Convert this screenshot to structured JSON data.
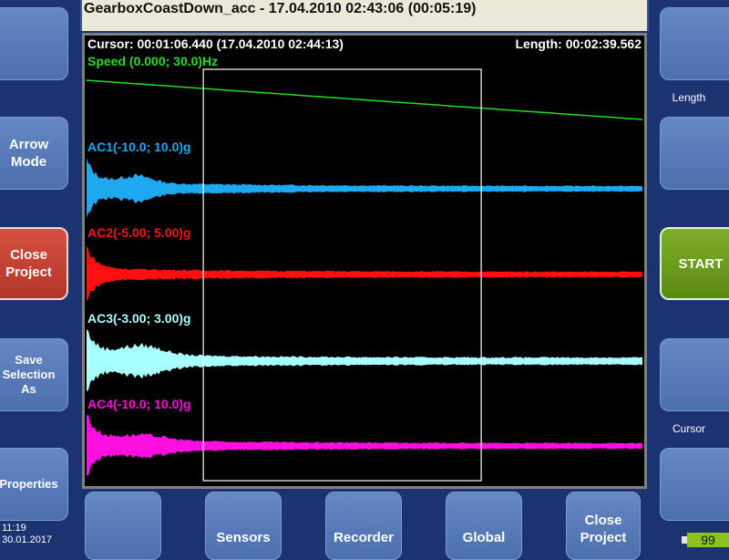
{
  "title": "GearboxCoastDown_acc - 17.04.2010 02:43:06 (00:05:19)",
  "cursor_text": "Cursor: 00:01:06.440 (17.04.2010 02:44:13)",
  "length_text": "Length: 00:02:39.562",
  "left_buttons": [
    {
      "label": ""
    },
    {
      "label": "Arrow Mode"
    },
    {
      "label": "Close Project"
    },
    {
      "label": "Save Selection As"
    },
    {
      "label": "Properties"
    }
  ],
  "right": {
    "length_label": "Length",
    "start_label": "START",
    "cursor_label": "Cursor"
  },
  "bottom_buttons": [
    {
      "label": ""
    },
    {
      "label": "Sensors"
    },
    {
      "label": "Recorder"
    },
    {
      "label": "Global"
    },
    {
      "label": "Close Project"
    }
  ],
  "clock": {
    "time": "11:19",
    "date": "30.01.2017"
  },
  "battery": "99",
  "chart_data": {
    "type": "line",
    "x_range_seconds": [
      0,
      319
    ],
    "selection": {
      "start_fraction": 0.21,
      "end_fraction": 0.71
    },
    "cursor_time": "00:01:06.440",
    "series": [
      {
        "name": "Speed",
        "label": "Speed (0.000; 30.0)Hz",
        "unit": "Hz",
        "range": [
          0.0,
          30.0
        ],
        "color": "#22dd22",
        "start": 22.7,
        "end": 18.0
      },
      {
        "name": "AC1",
        "label": "AC1(-10.0; 10.0)g",
        "unit": "g",
        "range": [
          -10.0,
          10.0
        ],
        "color": "#1ea8f0"
      },
      {
        "name": "AC2",
        "label": "AC2(-5.00; 5.00)g",
        "unit": "g",
        "range": [
          -5.0,
          5.0
        ],
        "color": "#ff1010"
      },
      {
        "name": "AC3",
        "label": "AC3(-3.00; 3.00)g",
        "unit": "g",
        "range": [
          -3.0,
          3.0
        ],
        "color": "#a8ffff"
      },
      {
        "name": "AC4",
        "label": "AC4(-10.0; 10.0)g",
        "unit": "g",
        "range": [
          -10.0,
          10.0
        ],
        "color": "#ff10e0"
      }
    ]
  }
}
